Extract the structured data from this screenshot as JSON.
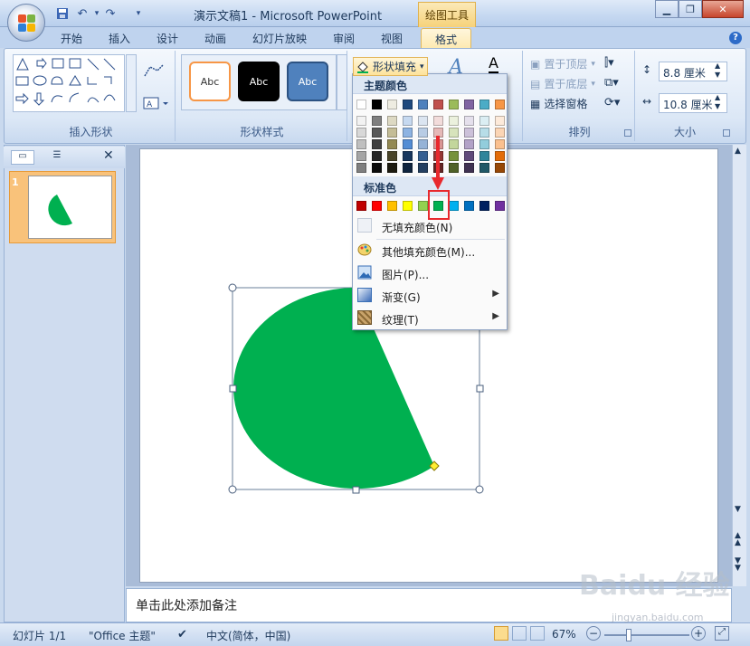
{
  "window": {
    "title": "演示文稿1 - Microsoft PowerPoint",
    "contextual_group": "绘图工具",
    "controls": [
      "minimize",
      "restore",
      "close"
    ]
  },
  "quick_access": [
    "save-icon",
    "undo-icon",
    "redo-icon",
    "customize-qat-icon"
  ],
  "tabs": [
    {
      "label": "开始",
      "active": false
    },
    {
      "label": "插入",
      "active": false
    },
    {
      "label": "设计",
      "active": false
    },
    {
      "label": "动画",
      "active": false
    },
    {
      "label": "幻灯片放映",
      "active": false
    },
    {
      "label": "审阅",
      "active": false
    },
    {
      "label": "视图",
      "active": false
    },
    {
      "label": "格式",
      "active": true
    }
  ],
  "ribbon": {
    "insert_shapes": {
      "label": "插入形状"
    },
    "shape_styles": {
      "label": "形状样式",
      "samples": [
        "Abc",
        "Abc",
        "Abc"
      ],
      "fill_button": "形状填充"
    },
    "arrange": {
      "label": "排列",
      "bring_to_front": "置于顶层",
      "send_to_back": "置于底层",
      "selection_pane": "选择窗格"
    },
    "size": {
      "label": "大小",
      "height": "8.8 厘米",
      "width": "10.8 厘米"
    }
  },
  "slides_pane": {
    "slide_number": "1"
  },
  "notes_placeholder": "单击此处添加备注",
  "status": {
    "slide": "幻灯片 1/1",
    "theme": "\"Office 主题\"",
    "language": "中文(简体，中国)",
    "zoom": "67%"
  },
  "fill_menu": {
    "theme_colors_label": "主题颜色",
    "standard_colors_label": "标准色",
    "no_fill": "无填充颜色(N)",
    "more_colors": "其他填充颜色(M)...",
    "picture": "图片(P)...",
    "gradient": "渐变(G)",
    "texture": "纹理(T)",
    "theme_top": [
      "#ffffff",
      "#000000",
      "#eeece1",
      "#1f497d",
      "#4f81bd",
      "#c0504d",
      "#9bbb59",
      "#8064a2",
      "#4bacc6",
      "#f79646"
    ],
    "theme_shades": [
      [
        "#f2f2f2",
        "#7f7f7f",
        "#ddd9c3",
        "#c6d9f0",
        "#dbe5f1",
        "#f2dcdb",
        "#ebf1dd",
        "#e5e0ec",
        "#dbeef3",
        "#fdeada"
      ],
      [
        "#d8d8d8",
        "#595959",
        "#c4bd97",
        "#8db3e2",
        "#b8cce4",
        "#e5b9b7",
        "#d7e3bc",
        "#ccc1d9",
        "#b7dde8",
        "#fbd5b5"
      ],
      [
        "#bfbfbf",
        "#3f3f3f",
        "#938953",
        "#548dd4",
        "#95b3d7",
        "#d99694",
        "#c3d69b",
        "#b2a2c7",
        "#92cddc",
        "#fac08f"
      ],
      [
        "#a5a5a5",
        "#262626",
        "#494429",
        "#17365d",
        "#366092",
        "#953734",
        "#76923c",
        "#5f497a",
        "#31859b",
        "#e36c09"
      ],
      [
        "#7f7f7f",
        "#0c0c0c",
        "#1d1b10",
        "#0f243e",
        "#244061",
        "#632423",
        "#4f6128",
        "#3f3151",
        "#205867",
        "#974806"
      ]
    ],
    "standard": [
      "#c00000",
      "#ff0000",
      "#ffc000",
      "#ffff00",
      "#92d050",
      "#00b050",
      "#00b0f0",
      "#0070c0",
      "#002060",
      "#7030a0"
    ],
    "selected_standard_index": 5
  },
  "shape": {
    "fill": "#00b050",
    "type": "pie"
  },
  "watermark": {
    "text": "Baidu 经验",
    "url": "jingyan.baidu.com"
  }
}
